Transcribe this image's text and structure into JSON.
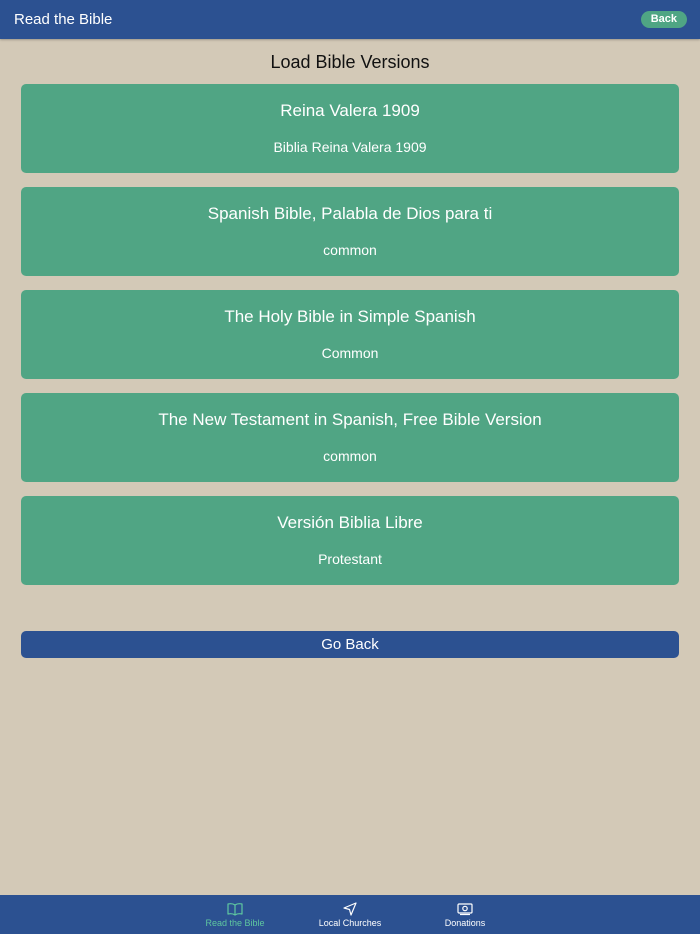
{
  "navbar": {
    "title": "Read the Bible",
    "back_label": "Back"
  },
  "page": {
    "heading": "Load Bible Versions"
  },
  "versions": [
    {
      "name": "Reina Valera 1909",
      "description": "Biblia Reina Valera 1909"
    },
    {
      "name": "Spanish Bible, Palabla de Dios para ti",
      "description": "common"
    },
    {
      "name": "The Holy Bible in Simple Spanish",
      "description": "Common"
    },
    {
      "name": "The New Testament in Spanish, Free Bible Version",
      "description": "common"
    },
    {
      "name": "Versión Biblia Libre",
      "description": "Protestant"
    }
  ],
  "go_back_label": "Go Back",
  "tabs": [
    {
      "label": "Read the Bible",
      "icon": "open-book-icon",
      "active": true
    },
    {
      "label": "Local Churches",
      "icon": "navigation-arrow-icon",
      "active": false
    },
    {
      "label": "Donations",
      "icon": "cash-icon",
      "active": false
    }
  ],
  "colors": {
    "primary": "#2c5191",
    "accent": "#50a584",
    "background": "#d3c9b7",
    "active_tab": "#5fc7a0"
  }
}
